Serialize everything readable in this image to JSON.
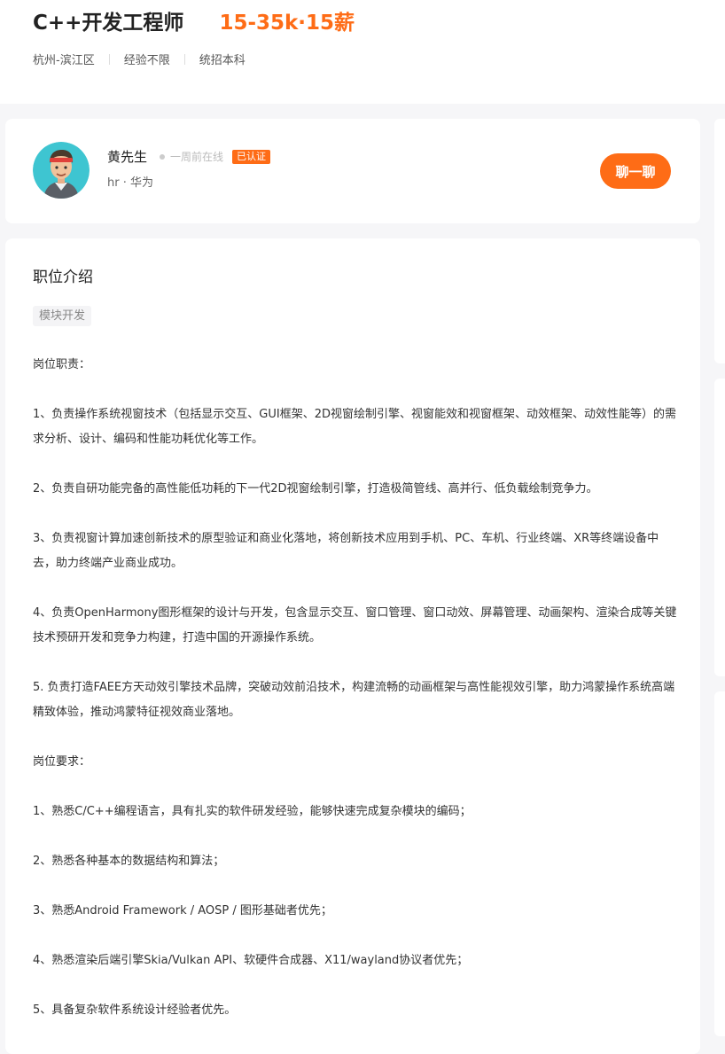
{
  "job": {
    "title": "C++开发工程师",
    "salary": "15-35k·15薪",
    "location": "杭州-滨江区",
    "experience": "经验不限",
    "education": "统招本科"
  },
  "hr": {
    "name": "黄先生",
    "online_status": "一周前在线",
    "verified_badge": "已认证",
    "subtitle": "hr · 华为",
    "chat_button": "聊一聊"
  },
  "description": {
    "section_title": "职位介绍",
    "tag": "模块开发",
    "paragraphs": [
      "岗位职责：",
      "1、负责操作系统视窗技术（包括显示交互、GUI框架、2D视窗绘制引擎、视窗能效和视窗框架、动效框架、动效性能等）的需求分析、设计、编码和性能功耗优化等工作。",
      "2、负责自研功能完备的高性能低功耗的下一代2D视窗绘制引擎，打造极简管线、高并行、低负载绘制竞争力。",
      "3、负责视窗计算加速创新技术的原型验证和商业化落地，将创新技术应用到手机、PC、车机、行业终端、XR等终端设备中去，助力终端产业商业成功。",
      "4、负责OpenHarmony图形框架的设计与开发，包含显示交互、窗口管理、窗口动效、屏幕管理、动画架构、渲染合成等关键技术预研开发和竞争力构建，打造中国的开源操作系统。",
      "5. 负责打造FAEE方天动效引擎技术品牌，突破动效前沿技术，构建流畅的动画框架与高性能视效引擎，助力鸿蒙操作系统高端精致体验，推动鸿蒙特征视效商业落地。",
      "岗位要求：",
      "1、熟悉C/C++编程语言，具有扎实的软件研发经验，能够快速完成复杂模块的编码；",
      "2、熟悉各种基本的数据结构和算法；",
      "3、熟悉Android Framework / AOSP / 图形基础者优先；",
      "4、熟悉渲染后端引擎Skia/Vulkan API、软硬件合成器、X11/wayland协议者优先；",
      "5、具备复杂软件系统设计经验者优先。"
    ]
  },
  "colors": {
    "accent": "#fe6c16",
    "page_bg": "#f6f6f8",
    "avatar_bg": "#3ec5d1"
  }
}
